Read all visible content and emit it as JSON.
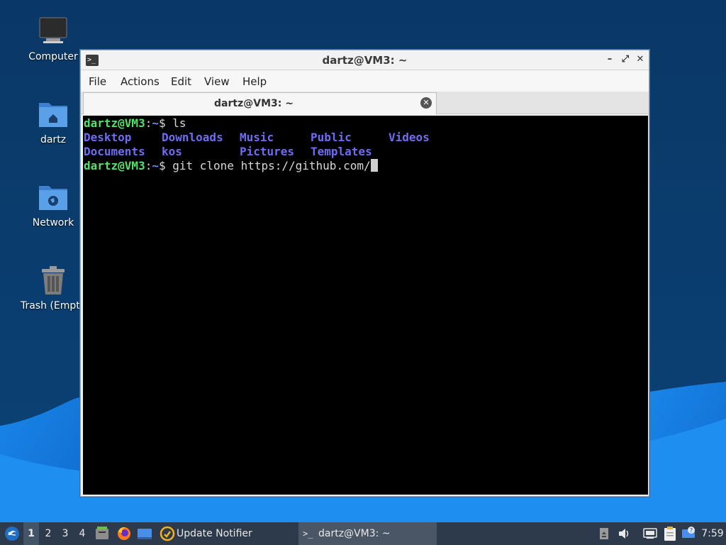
{
  "desktop": {
    "icons": [
      {
        "label": "Computer",
        "icon": "monitor-icon"
      },
      {
        "label": "dartz",
        "icon": "home-folder-icon"
      },
      {
        "label": "Network",
        "icon": "network-folder-icon"
      },
      {
        "label": "Trash (Empty",
        "icon": "trash-icon"
      }
    ]
  },
  "window": {
    "title": "dartz@VM3: ~",
    "app_icon_glyph": ">_",
    "controls": {
      "minimize": "–",
      "maximize": "⤢",
      "close": "✕"
    },
    "menu": [
      "File",
      "Actions",
      "Edit",
      "View",
      "Help"
    ],
    "tab": {
      "label": "dartz@VM3: ~",
      "close_glyph": "✕"
    }
  },
  "terminal": {
    "prompt_user": "dartz@VM3",
    "prompt_sep": ":",
    "prompt_path": "~",
    "prompt_end": "$ ",
    "cmd1": "ls",
    "ls_row1": [
      "Desktop",
      "Downloads",
      "Music",
      "Public",
      "Videos"
    ],
    "ls_row2": [
      "Documents",
      "kos",
      "Pictures",
      "Templates"
    ],
    "cmd2": "git clone https://github.com/"
  },
  "taskbar": {
    "workspaces": [
      "1",
      "2",
      "3",
      "4"
    ],
    "active_workspace": "1",
    "launchers": [
      "file-manager-icon",
      "firefox-icon",
      "desktop-icon"
    ],
    "update_notifier": "Update Notifier",
    "task_terminal": "dartz@VM3: ~",
    "clock": "7:59",
    "tray_icons": [
      "eject-icon",
      "volume-icon",
      "network-icon",
      "clipboard-icon",
      "notification-icon"
    ]
  },
  "colors": {
    "desktop_bg": "#0b3a66",
    "accent_wave": "#1e88e5",
    "prompt_green": "#54e26b",
    "dir_blue": "#6f6cf5"
  }
}
